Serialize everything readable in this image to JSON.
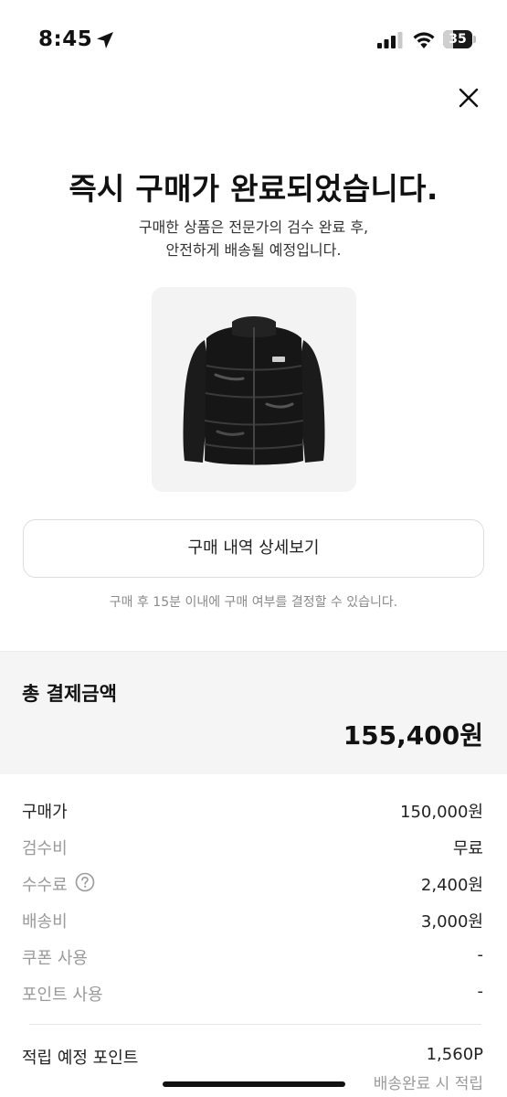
{
  "status_bar": {
    "time": "8:45",
    "battery_level": "35",
    "icons": [
      "location-arrow-icon",
      "cellular-signal-icon",
      "wifi-icon",
      "battery-icon"
    ]
  },
  "header": {
    "close_icon": "close-icon"
  },
  "confirmation": {
    "title": "즉시 구매가 완료되었습니다.",
    "subtitle_line1": "구매한 상품은 전문가의 검수 완료 후,",
    "subtitle_line2": "안전하게 배송될 예정입니다."
  },
  "actions": {
    "detail_button_label": "구매 내역 상세보기",
    "decision_note": "구매 후 15분 이내에 구매 여부를 결정할 수 있습니다."
  },
  "payment": {
    "total_label": "총 결제금액",
    "total_amount": "155,400원",
    "rows": [
      {
        "label": "구매가",
        "value": "150,000원"
      },
      {
        "label": "검수비",
        "value": "무료"
      },
      {
        "label": "수수료",
        "value": "2,400원"
      },
      {
        "label": "배송비",
        "value": "3,000원"
      },
      {
        "label": "쿠폰 사용",
        "value": "-"
      },
      {
        "label": "포인트 사용",
        "value": "-"
      }
    ]
  },
  "points": {
    "label": "적립 예정 포인트",
    "value": "1,560P",
    "note": "배송완료 시 적립"
  },
  "colors": {
    "accent_text": "#111111",
    "muted_text": "#9a9a9a",
    "section_bg": "#f5f5f5"
  }
}
